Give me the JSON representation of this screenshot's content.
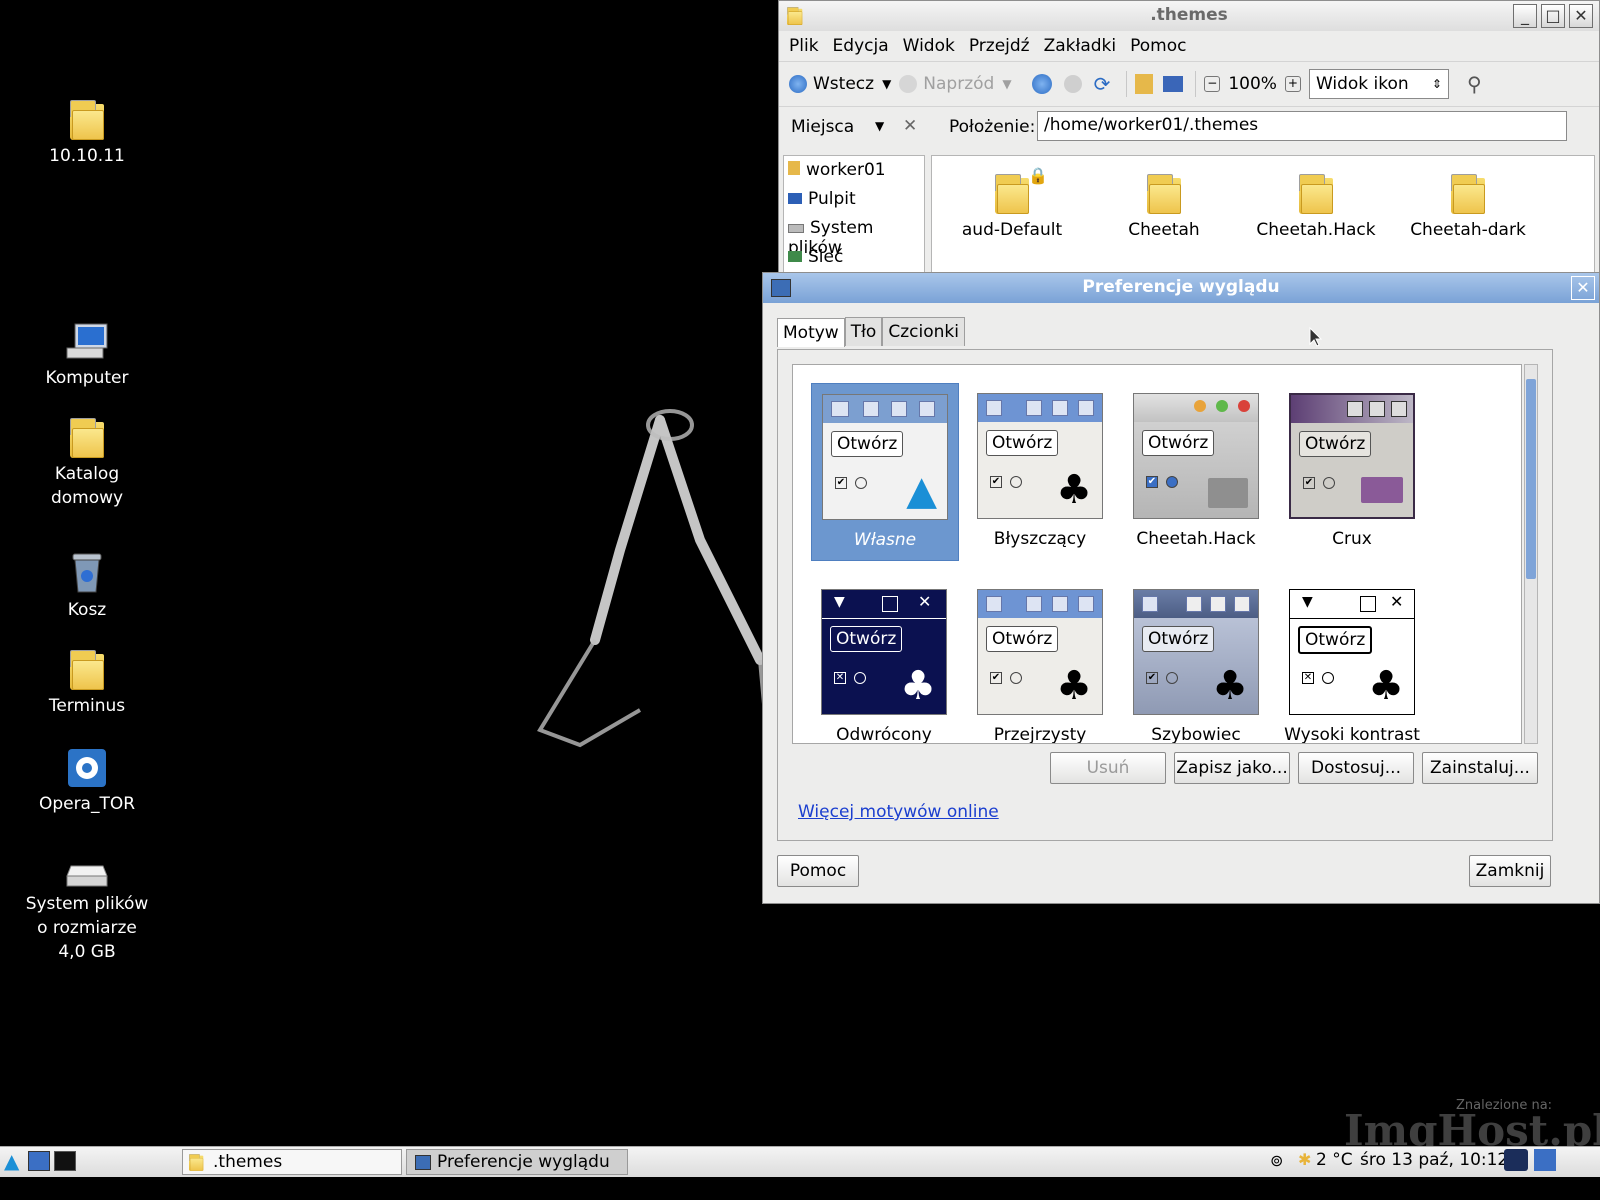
{
  "desktop": {
    "icons": [
      {
        "label": "10.10.11",
        "icon": "folder-icon"
      },
      {
        "label": "Komputer",
        "icon": "computer-icon"
      },
      {
        "label": "Katalog domowy",
        "icon": "home-folder-icon"
      },
      {
        "label": "Kosz",
        "icon": "trash-icon"
      },
      {
        "label": "Terminus",
        "icon": "folder-icon"
      },
      {
        "label": "Opera_TOR",
        "icon": "gear-icon"
      },
      {
        "label": "System plików o rozmiarze 4,0 GB",
        "icon": "drive-icon"
      }
    ]
  },
  "file_manager": {
    "title": ".themes",
    "menu": [
      "Plik",
      "Edycja",
      "Widok",
      "Przejdź",
      "Zakładki",
      "Pomoc"
    ],
    "toolbar": {
      "back": "Wstecz",
      "forward": "Naprzód",
      "zoom": "100%",
      "view_mode": "Widok ikon"
    },
    "places_label": "Miejsca",
    "location_label": "Położenie:",
    "location_value": "/home/worker01/.themes",
    "places": [
      "worker01",
      "Pulpit",
      "System plików",
      "Sieć"
    ],
    "items": [
      "aud-Default",
      "Cheetah",
      "Cheetah.Hack",
      "Cheetah-dark"
    ]
  },
  "appearance_dialog": {
    "title": "Preferencje wyglądu",
    "tabs": [
      "Motyw",
      "Tło",
      "Czcionki"
    ],
    "sample_button": "Otwórz",
    "themes": [
      "Własne",
      "Błyszczący",
      "Cheetah.Hack",
      "Crux",
      "Odwrócony",
      "Przejrzysty",
      "Szybowiec",
      "Wysoki kontrast"
    ],
    "buttons": {
      "remove": "Usuń",
      "save_as": "Zapisz jako...",
      "customize": "Dostosuj...",
      "install": "Zainstaluj..."
    },
    "more_link": "Więcej motywów online",
    "help": "Pomoc",
    "close": "Zamknij"
  },
  "taskbar": {
    "windows": [
      ".themes",
      "Preferencje wyglądu"
    ],
    "temperature": "2 °C",
    "clock": "śro 13 paź, 10:12"
  },
  "watermark": "ImgHost.pl",
  "watermark_sub": "Znalezione na:",
  "colors": {
    "selection": "#6c97cf",
    "titlebar_active": "#8fb1dc",
    "link": "#1a3ecf"
  }
}
